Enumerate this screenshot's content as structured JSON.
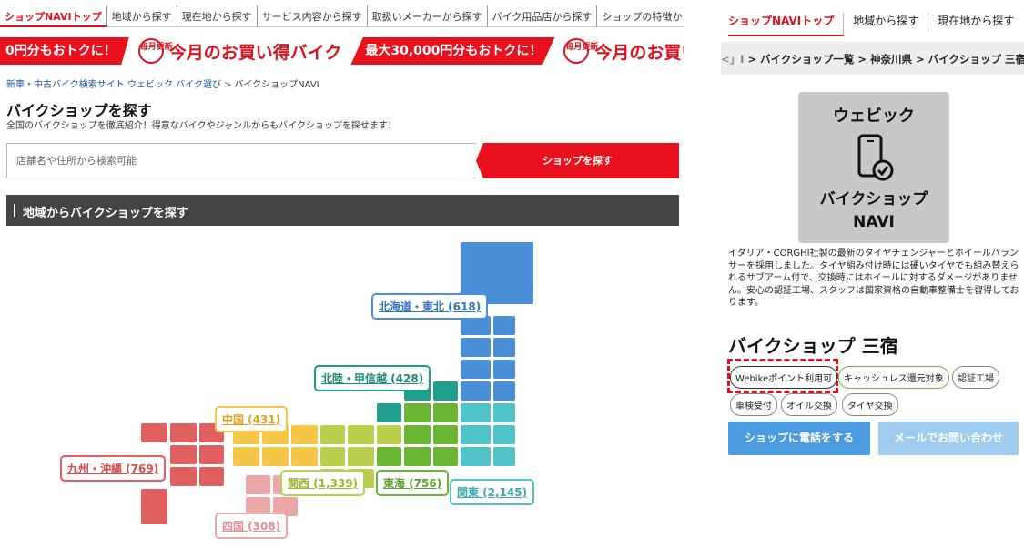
{
  "left": {
    "nav": [
      "ショップNAVIトップ",
      "地域から探す",
      "現在地から探す",
      "サービス内容から探す",
      "取扱いメーカーから探す",
      "バイク用品店から探す",
      "ショップの特徴から探す"
    ],
    "banner": {
      "promo_a": "0円分もおトクに！",
      "badge": "毎月更新",
      "headline": "今月のお買い得バイク",
      "promo_b": "最大30,000円分もおトクに！"
    },
    "breadcrumb": {
      "home": "新車・中古バイク検索サイト ウェビック バイク選び",
      "sep": ">",
      "current": "バイクショップNAVI"
    },
    "title": "バイクショップを探す",
    "subtitle": "全国のバイクショップを徹底紹介！得意なバイクやジャンルからもバイクショップを探せます！",
    "search": {
      "placeholder": "店舗名や住所から検索可能",
      "button": "ショップを探す"
    },
    "section_title": "地域からバイクショップを探す",
    "regions": {
      "hokkaido_tohoku": "北海道・東北 (618)",
      "hokuriku_koshinetsu": "北陸・甲信越 (428)",
      "chugoku": "中国 (431)",
      "kyushu_okinawa": "九州・沖縄 (769)",
      "kansai": "関西 (1,339)",
      "tokai": "東海 (756)",
      "kanto": "関東 (2,145)",
      "shikoku": "四国 (308)"
    },
    "region_colors": {
      "hokkaido_tohoku": "#4a90d9",
      "hokuriku_koshinetsu": "#1f9e8c",
      "chugoku": "#f5c545",
      "kyushu_okinawa": "#e06060",
      "kansai": "#b9cf4d",
      "tokai": "#6ab531",
      "kanto": "#4fc3c7",
      "shikoku": "#eca8a8"
    }
  },
  "right": {
    "nav": [
      "ショップNAVIトップ",
      "地域から探す",
      "現在地から探す"
    ],
    "breadcrumb": {
      "prefix": "<」I",
      "items": [
        "バイクショップ一覧",
        "神奈川県",
        "バイクショップ 三宿"
      ],
      "sep": ">"
    },
    "logo": {
      "top": "ウェビック",
      "bottom1": "バイクショップ",
      "bottom2": "NAVI"
    },
    "description": "イタリア・CORGHI社製の最新のタイヤチェンジャーとホイールバランサーを採用しました。タイヤ組み付け時には硬いタイヤでも組み替えられるサブアーム付で、交換時にはホイールに対するダメージがありません。安心の認証工場、スタッフは国家資格の自動車整備士を習得しております。",
    "shop_name": "バイクショップ 三宿",
    "tags": [
      "Webikeポイント利用可",
      "キャッシュレス還元対象",
      "認証工場",
      "車検受付",
      "オイル交換",
      "タイヤ交換"
    ],
    "buttons": {
      "call": "ショップに電話をする",
      "mail": "メールでお問い合わせ"
    }
  }
}
